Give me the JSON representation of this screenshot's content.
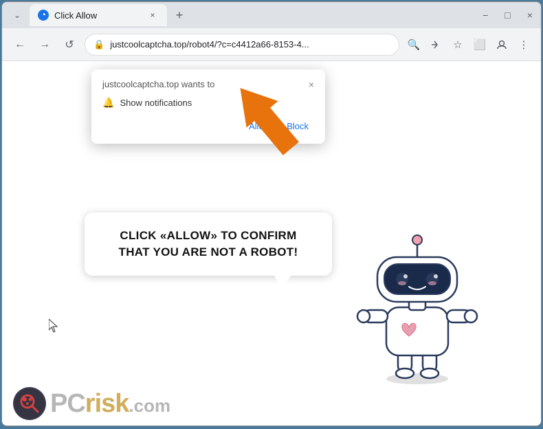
{
  "window": {
    "title": "Click Allow",
    "border_color": "#4a7a9b"
  },
  "titlebar": {
    "tab_label": "Click Allow",
    "new_tab_label": "+",
    "controls": {
      "minimize": "−",
      "maximize": "□",
      "close": "×",
      "chevron": "⌄"
    }
  },
  "addressbar": {
    "back": "←",
    "forward": "→",
    "reload": "↺",
    "url": "justcoolcaptcha.top/robot4/?c=c4412a66-8153-4...",
    "lock": "🔒",
    "search_icon": "🔍",
    "share_icon": "⎋",
    "star_icon": "☆",
    "tab_icon": "⬜",
    "user_icon": "👤",
    "menu_icon": "⋮"
  },
  "notification_popup": {
    "title": "justcoolcaptcha.top wants to",
    "notification_label": "Show notifications",
    "allow_btn": "Allow",
    "block_btn": "Block",
    "close_btn": "×"
  },
  "speech_bubble": {
    "text": "CLICK «ALLOW» TO CONFIRM THAT YOU ARE NOT A ROBOT!"
  },
  "pcrisk": {
    "text_pc": "PC",
    "text_risk": "risk",
    "text_dotcom": ".com"
  },
  "colors": {
    "orange_arrow": "#e8720c",
    "allow_btn": "#1a73e8",
    "block_btn": "#1a73e8",
    "bubble_text": "#111111",
    "pcrisk_pc": "#999999",
    "pcrisk_risk": "#c8a040"
  }
}
